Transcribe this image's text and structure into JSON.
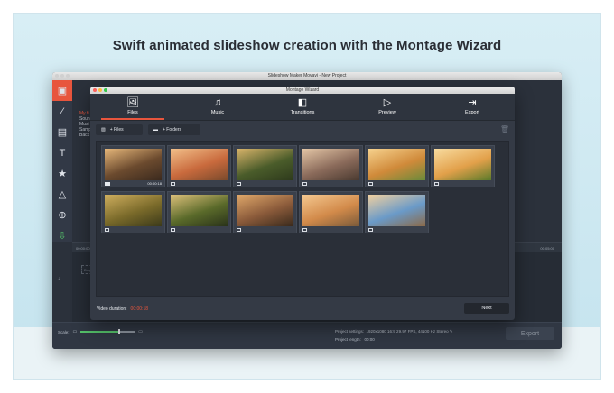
{
  "headline": "Swift animated slideshow creation with the Montage Wizard",
  "app": {
    "title": "Slideshow Maker Movavi - New Project",
    "sidebar_lines": [
      "My fi",
      "Soun",
      "Musi",
      "Samp",
      "Back"
    ],
    "tools": [
      {
        "icon": "import-icon",
        "glyph": "▣"
      },
      {
        "icon": "magic-wand-icon",
        "glyph": "⁄"
      },
      {
        "icon": "filmstrip-icon",
        "glyph": "▤"
      },
      {
        "icon": "titles-icon",
        "glyph": "T"
      },
      {
        "icon": "stickers-icon",
        "glyph": "★"
      },
      {
        "icon": "transitions-icon",
        "glyph": "△"
      },
      {
        "icon": "zoom-icon",
        "glyph": "⊕"
      },
      {
        "icon": "export-icon",
        "glyph": "⇩"
      }
    ],
    "timeline": {
      "time_start": "00:00:00",
      "time_end": "00:05:00",
      "track_label": "Drop"
    },
    "footer": {
      "scale_label": "Scale:",
      "scale_value": 0.7,
      "project_settings_label": "Project settings:",
      "project_settings_value": "1920x1080 16:9 29.97 FPS, 44100 Hz Stereo",
      "project_length_label": "Project length:",
      "project_length_value": "00:00",
      "export_label": "Export"
    }
  },
  "wizard": {
    "title": "Montage Wizard",
    "tabs": [
      {
        "label": "Files",
        "icon": "files-icon",
        "glyph": "🖼",
        "active": true
      },
      {
        "label": "Music",
        "icon": "music-icon",
        "glyph": "♫",
        "active": false
      },
      {
        "label": "Transitions",
        "icon": "transitions-icon",
        "glyph": "◧",
        "active": false
      },
      {
        "label": "Preview",
        "icon": "preview-icon",
        "glyph": "▷",
        "active": false
      },
      {
        "label": "Export",
        "icon": "export-icon",
        "glyph": "⇥",
        "active": false
      }
    ],
    "add_files_label": "+ Files",
    "add_folders_label": "+ Folders",
    "thumbnails": [
      {
        "type": "video",
        "time": "00:00:18",
        "colors": [
          "#6b4a2e",
          "#e6b77a",
          "#3b2a1e"
        ]
      },
      {
        "type": "image",
        "colors": [
          "#c96a3d",
          "#f2c08a",
          "#7a4a2c"
        ]
      },
      {
        "type": "image",
        "colors": [
          "#4a5c2a",
          "#d9b46a",
          "#2e3a1c"
        ]
      },
      {
        "type": "image",
        "colors": [
          "#8a6a5a",
          "#e4c6a6",
          "#4a3a30"
        ]
      },
      {
        "type": "image",
        "colors": [
          "#d08a3a",
          "#f6d28e",
          "#6a8a3a"
        ]
      },
      {
        "type": "image",
        "colors": [
          "#e2a04a",
          "#f8dca0",
          "#5a7a2a"
        ]
      },
      {
        "type": "image",
        "colors": [
          "#7a6a2a",
          "#cfae5e",
          "#3c3a1a"
        ]
      },
      {
        "type": "image",
        "colors": [
          "#5a6a2a",
          "#dcc07a",
          "#2a331a"
        ]
      },
      {
        "type": "image",
        "colors": [
          "#8a5a3a",
          "#e0a86a",
          "#3a2a1c"
        ]
      },
      {
        "type": "image",
        "colors": [
          "#d28a4a",
          "#f4c890",
          "#7a5a3a"
        ]
      },
      {
        "type": "image",
        "colors": [
          "#6a9ac8",
          "#f0d0a0",
          "#8a6a4a"
        ]
      }
    ],
    "duration_label": "Video duration:",
    "duration_value": "00:00:18",
    "next_label": "Next"
  }
}
